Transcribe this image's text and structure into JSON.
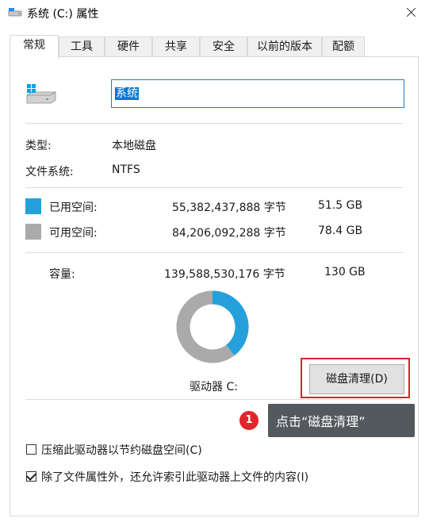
{
  "window": {
    "title": "系统 (C:) 属性"
  },
  "tabs": [
    {
      "label": "常规",
      "active": true
    },
    {
      "label": "工具"
    },
    {
      "label": "硬件"
    },
    {
      "label": "共享"
    },
    {
      "label": "安全"
    },
    {
      "label": "以前的版本"
    },
    {
      "label": "配额"
    }
  ],
  "drive": {
    "name": "系统"
  },
  "info": {
    "type_label": "类型:",
    "type_value": "本地磁盘",
    "fs_label": "文件系统:",
    "fs_value": "NTFS"
  },
  "space": {
    "used": {
      "label": "已用空间:",
      "bytes": "55,382,437,888 字节",
      "size": "51.5 GB",
      "color": "#26a0da"
    },
    "free": {
      "label": "可用空间:",
      "bytes": "84,206,092,288 字节",
      "size": "78.4 GB",
      "color": "#aaaaaa"
    },
    "capacity": {
      "label": "容量:",
      "bytes": "139,588,530,176 字节",
      "size": "130 GB"
    }
  },
  "chart_data": {
    "type": "pie",
    "categories": [
      "已用空间",
      "可用空间"
    ],
    "values": [
      55382437888,
      84206092288
    ],
    "colors": [
      "#26a0da",
      "#aaaaaa"
    ]
  },
  "drive_label": "驱动器 C:",
  "cleanup_button": "磁盘清理(D)",
  "annotation": {
    "step": "1",
    "text": "点击“磁盘清理”"
  },
  "options": {
    "compress": {
      "label": "压缩此驱动器以节约磁盘空间(C)",
      "checked": false
    },
    "index": {
      "label": "除了文件属性外，还允许索引此驱动器上文件的内容(I)",
      "checked": true
    }
  }
}
